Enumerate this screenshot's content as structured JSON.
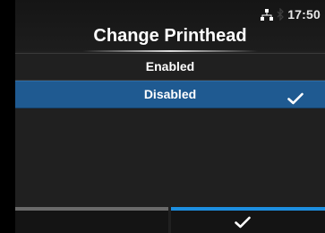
{
  "status": {
    "time": "17:50",
    "icons": [
      "network-icon",
      "bluetooth-icon"
    ]
  },
  "header": {
    "title": "Change Printhead"
  },
  "options": [
    {
      "label": "Enabled",
      "selected": false
    },
    {
      "label": "Disabled",
      "selected": true
    }
  ],
  "footer": {
    "left_key": "",
    "right_key_icon": "check-icon"
  },
  "colors": {
    "selection": "#1f5a91",
    "accent": "#1d8fe0",
    "background": "#202020",
    "text": "#ffffff"
  }
}
